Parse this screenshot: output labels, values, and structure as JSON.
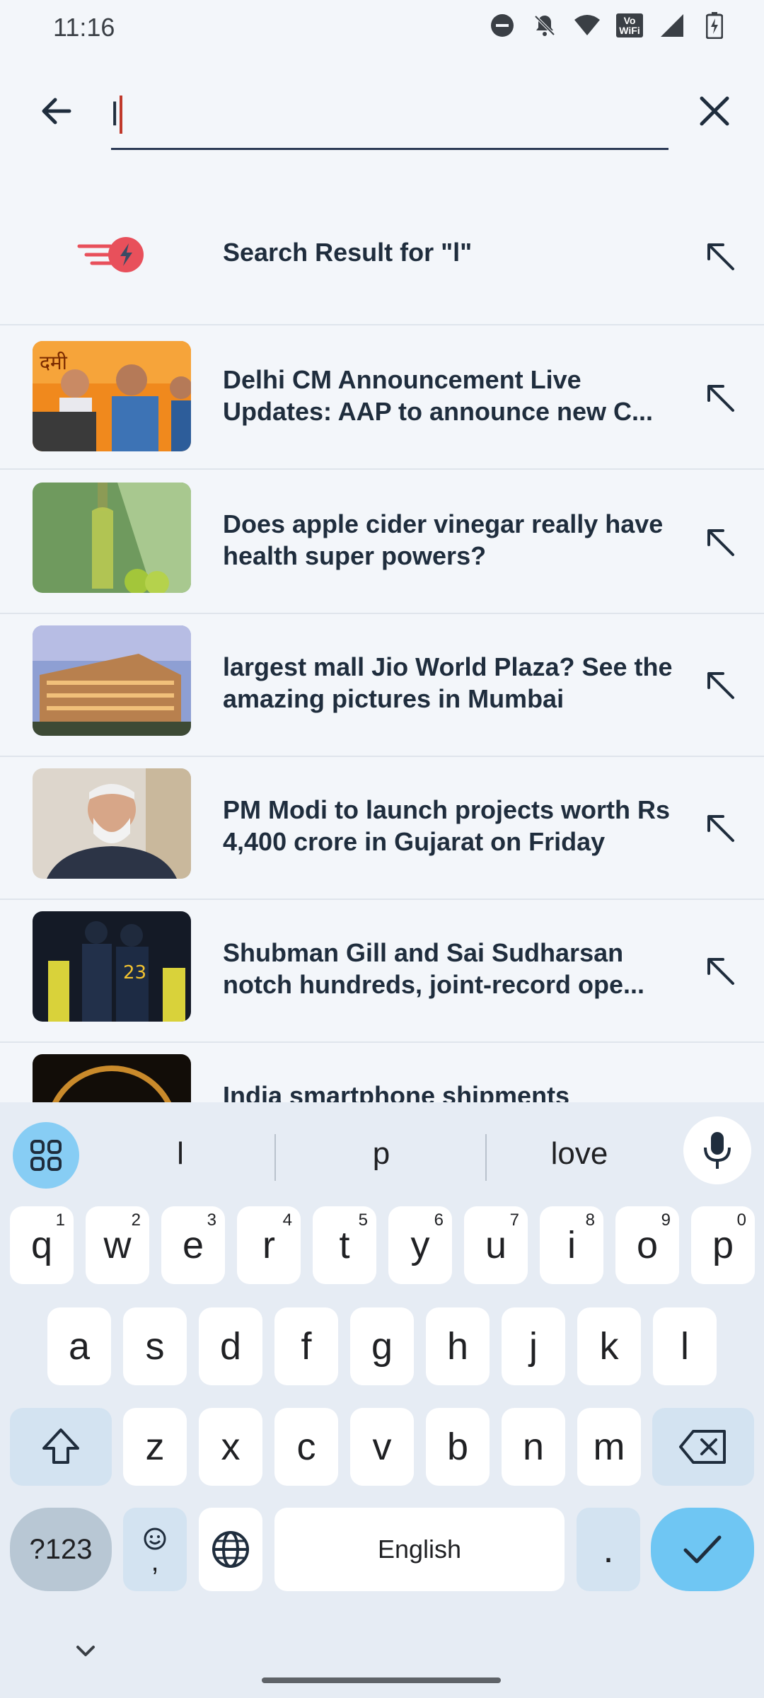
{
  "status_bar": {
    "time": "11:16",
    "vowifi_line1": "Vo",
    "vowifi_line2": "WiFi"
  },
  "search": {
    "value": "l",
    "placeholder": ""
  },
  "results": [
    {
      "title": "Search Result for \"l\"",
      "kind": "search-logo"
    },
    {
      "title": "Delhi CM Announcement Live Updates: AAP to announce new C...",
      "thumb": "delhi-cm-thumbnail"
    },
    {
      "title": "Does apple cider vinegar really have health super powers?",
      "thumb": "apple-cider-thumbnail"
    },
    {
      "title": "largest mall Jio World Plaza? See the amazing pictures in Mumbai",
      "thumb": "jio-plaza-thumbnail"
    },
    {
      "title": "PM Modi to launch projects worth Rs 4,400 crore in Gujarat on Friday",
      "thumb": "modi-thumbnail"
    },
    {
      "title": "Shubman Gill and Sai Sudharsan notch hundreds, joint-record ope...",
      "thumb": "cricket-thumbnail"
    },
    {
      "title": "India smartphone shipments",
      "thumb": "smartphone-thumbnail"
    }
  ],
  "keyboard": {
    "suggestions": [
      "l",
      "p",
      "love"
    ],
    "row1": [
      {
        "k": "q",
        "n": "1"
      },
      {
        "k": "w",
        "n": "2"
      },
      {
        "k": "e",
        "n": "3"
      },
      {
        "k": "r",
        "n": "4"
      },
      {
        "k": "t",
        "n": "5"
      },
      {
        "k": "y",
        "n": "6"
      },
      {
        "k": "u",
        "n": "7"
      },
      {
        "k": "i",
        "n": "8"
      },
      {
        "k": "o",
        "n": "9"
      },
      {
        "k": "p",
        "n": "0"
      }
    ],
    "row2": [
      "a",
      "s",
      "d",
      "f",
      "g",
      "h",
      "j",
      "k",
      "l"
    ],
    "row3": [
      "z",
      "x",
      "c",
      "v",
      "b",
      "n",
      "m"
    ],
    "symbols_label": "?123",
    "emoji_comma": ",",
    "space_label": "English",
    "period_label": "."
  },
  "colors": {
    "background": "#f3f6fa",
    "accent_blue": "#6fc6f3",
    "logo_red": "#e8505b",
    "title_text": "#1f2d3d"
  }
}
